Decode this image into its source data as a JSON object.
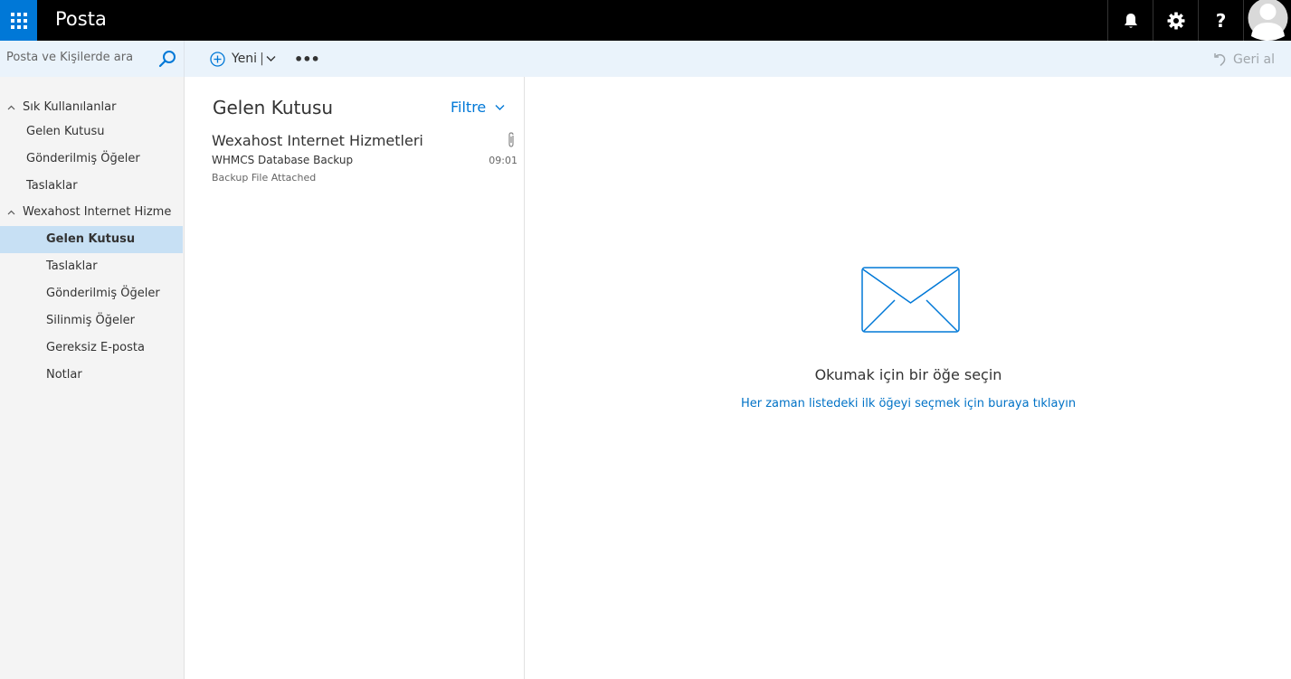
{
  "app": {
    "title": "Posta"
  },
  "topbar": {
    "icons": [
      "waffle-icon",
      "bell-icon",
      "gear-icon",
      "help-icon",
      "avatar-icon"
    ],
    "help_label": "?"
  },
  "search": {
    "placeholder": "Posta ve Kişilerde ara"
  },
  "commands": {
    "new_label": "Yeni",
    "new_separator": "|",
    "more_label": "•••",
    "undo_label": "Geri al"
  },
  "nav": {
    "favorites": {
      "header": "Sık Kullanılanlar",
      "items": [
        "Gelen Kutusu",
        "Gönderilmiş Öğeler",
        "Taslaklar"
      ]
    },
    "account": {
      "header": "Wexahost Internet Hizme",
      "items": [
        "Gelen Kutusu",
        "Taslaklar",
        "Gönderilmiş Öğeler",
        "Silinmiş Öğeler",
        "Gereksiz E-posta",
        "Notlar"
      ],
      "selected": "Gelen Kutusu"
    }
  },
  "message_list": {
    "title": "Gelen Kutusu",
    "filter_label": "Filtre",
    "messages": [
      {
        "sender": "Wexahost Internet Hizmetleri",
        "subject": "WHMCS Database Backup",
        "preview": "Backup File Attached",
        "time": "09:01",
        "has_attachment": true
      }
    ]
  },
  "reading_pane": {
    "empty_title": "Okumak için bir öğe seçin",
    "empty_link": "Her zaman listedeki ilk öğeyi seçmek için buraya tıklayın"
  },
  "colors": {
    "accent": "#0078d7",
    "topbar": "#000000",
    "commandbar": "#eaf3fb",
    "selected_nav": "#c7e0f4",
    "link": "#0072c6"
  }
}
